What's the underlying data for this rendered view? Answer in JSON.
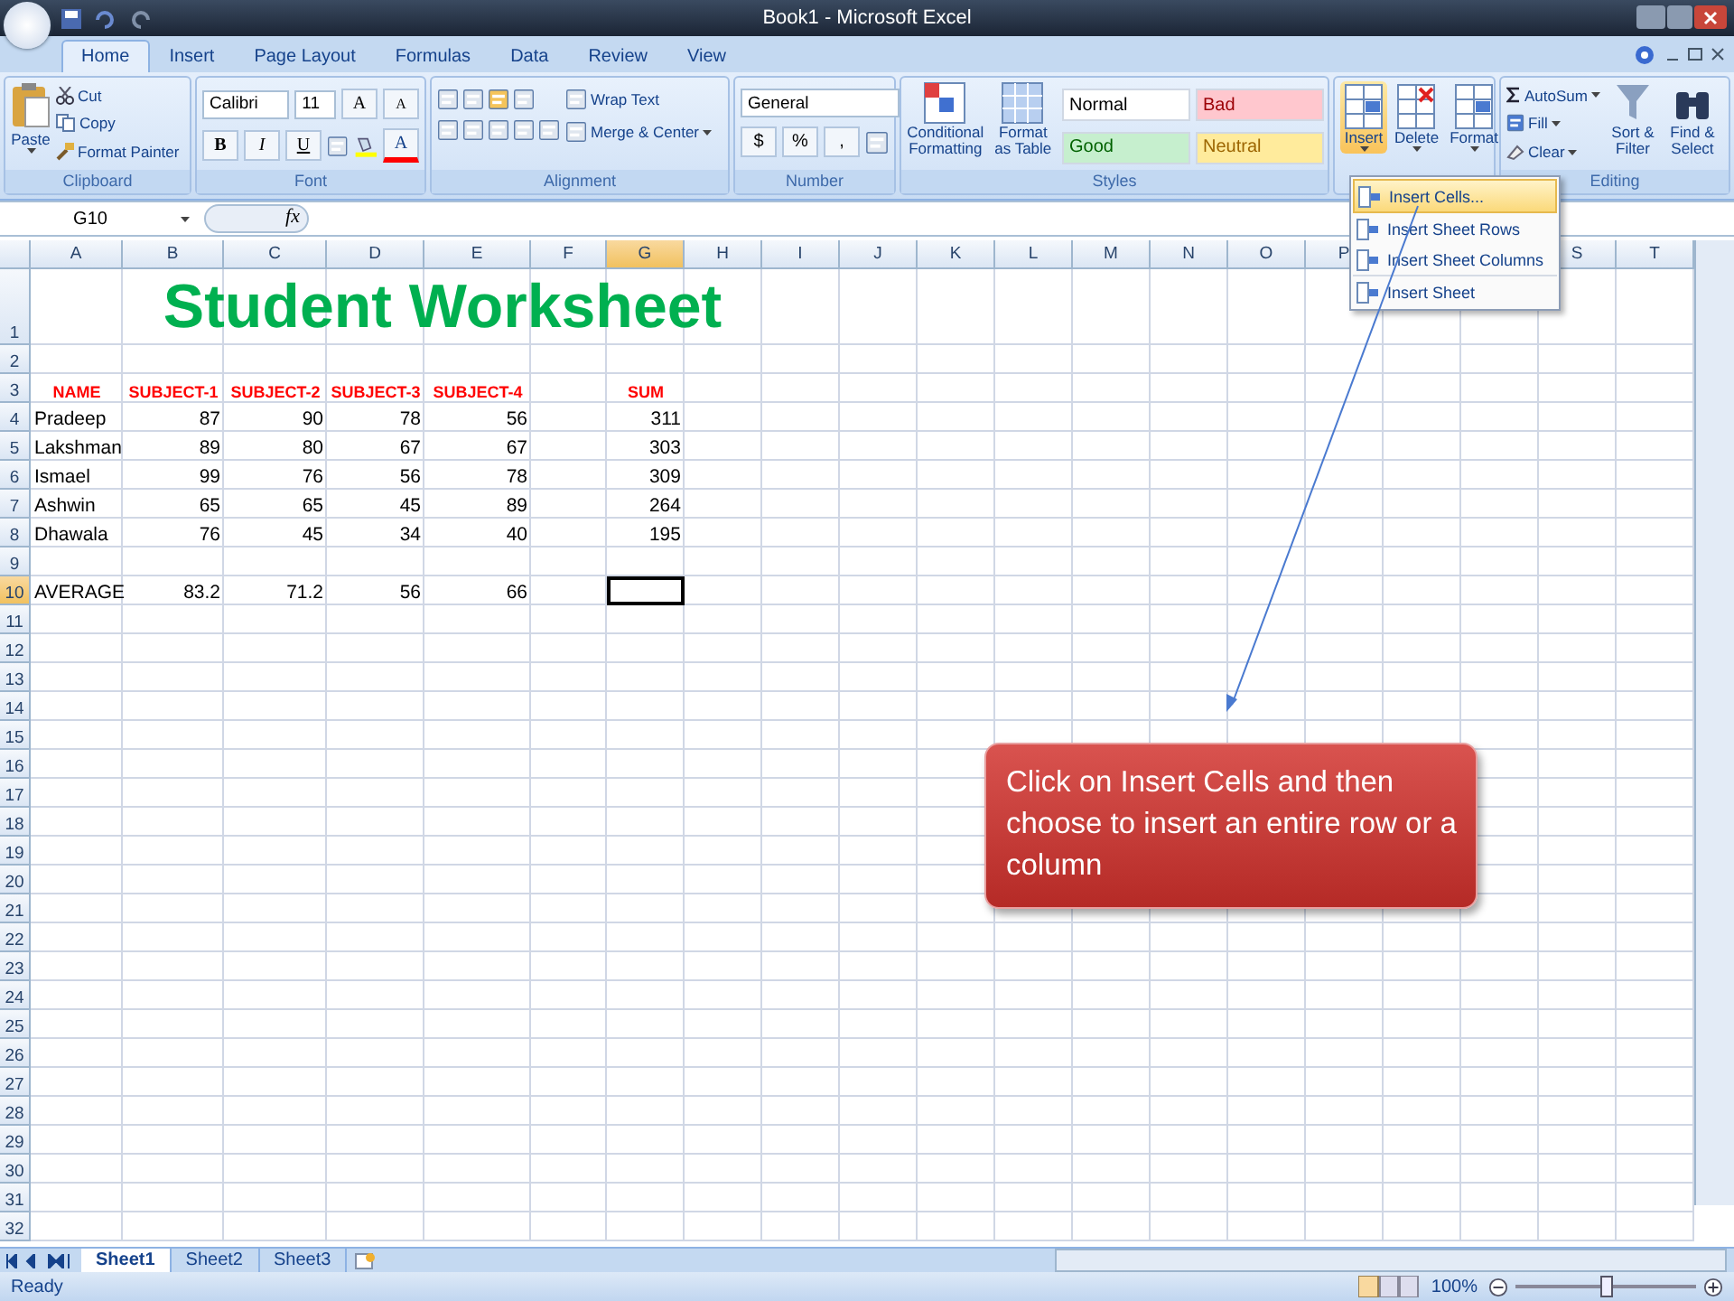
{
  "window": {
    "title": "Book1 - Microsoft Excel"
  },
  "ribbon_tabs": [
    {
      "label": "Home",
      "selected": true
    },
    {
      "label": "Insert",
      "selected": false
    },
    {
      "label": "Page Layout",
      "selected": false
    },
    {
      "label": "Formulas",
      "selected": false
    },
    {
      "label": "Data",
      "selected": false
    },
    {
      "label": "Review",
      "selected": false
    },
    {
      "label": "View",
      "selected": false
    }
  ],
  "clipboard": {
    "label": "Clipboard",
    "paste": "Paste",
    "cut": "Cut",
    "copy": "Copy",
    "format_painter": "Format Painter"
  },
  "font": {
    "label": "Font",
    "font_name": "Calibri",
    "font_size": "11",
    "grow": "A",
    "shrink": "A",
    "bold": "B",
    "italic": "I",
    "underline": "U",
    "font_color": "A"
  },
  "alignment": {
    "label": "Alignment",
    "wrap_text": "Wrap Text",
    "merge": "Merge & Center"
  },
  "number": {
    "label": "Number",
    "format": "General",
    "currency": "$",
    "percent": "%",
    "comma": ","
  },
  "styles": {
    "label": "Styles",
    "conditional": "Conditional Formatting",
    "format_table": "Format as Table",
    "cell_styles": [
      {
        "label": "Normal",
        "color": "#ffffff"
      },
      {
        "label": "Bad",
        "color": "#ffc7ce"
      },
      {
        "label": "Good",
        "color": "#c6efce"
      },
      {
        "label": "Neutral",
        "color": "#ffeb9c"
      }
    ]
  },
  "cells": {
    "buttons": [
      {
        "label": "Insert",
        "pressed": true
      },
      {
        "label": "Delete",
        "pressed": false
      },
      {
        "label": "Format",
        "pressed": false
      }
    ]
  },
  "editing": {
    "label": "Editing",
    "autosum": "AutoSum",
    "fill": "Fill",
    "clear": "Clear",
    "sort": "Sort & Filter",
    "find": "Find & Select"
  },
  "formula_bar": {
    "name_box": "G10",
    "fx": "fx"
  },
  "insert_menu": [
    {
      "label": "Insert Cells...",
      "selected": true
    },
    {
      "label": "Insert Sheet Rows",
      "selected": false
    },
    {
      "label": "Insert Sheet Columns",
      "selected": false
    },
    {
      "label": "Insert Sheet",
      "selected": false
    }
  ],
  "sheet": {
    "columns": [
      {
        "label": "A",
        "selected": false
      },
      {
        "label": "B",
        "selected": false
      },
      {
        "label": "C",
        "selected": false
      },
      {
        "label": "D",
        "selected": false
      },
      {
        "label": "E",
        "selected": false
      },
      {
        "label": "F",
        "selected": false
      },
      {
        "label": "G",
        "selected": true
      },
      {
        "label": "H",
        "selected": false
      },
      {
        "label": "I",
        "selected": false
      },
      {
        "label": "J",
        "selected": false
      },
      {
        "label": "K",
        "selected": false
      },
      {
        "label": "L",
        "selected": false
      },
      {
        "label": "M",
        "selected": false
      },
      {
        "label": "N",
        "selected": false
      },
      {
        "label": "O",
        "selected": false
      },
      {
        "label": "P",
        "selected": false
      },
      {
        "label": "S",
        "selected": false
      },
      {
        "label": "T",
        "selected": false
      }
    ],
    "rows": [
      {
        "number": "1",
        "selected": false,
        "kind": "title",
        "title": "Student Worksheet"
      },
      {
        "number": "2",
        "selected": false,
        "kind": "data"
      },
      {
        "number": "3",
        "selected": false,
        "kind": "heading",
        "cells": {
          "A": "NAME",
          "B": "SUBJECT-1",
          "C": "SUBJECT-2",
          "D": "SUBJECT-3",
          "E": "SUBJECT-4",
          "G": "SUM"
        }
      },
      {
        "number": "4",
        "selected": false,
        "kind": "data",
        "cells": {
          "A": "Pradeep",
          "B": "87",
          "C": "90",
          "D": "78",
          "E": "56",
          "G": "311"
        }
      },
      {
        "number": "5",
        "selected": false,
        "kind": "data",
        "cells": {
          "A": "Lakshman",
          "B": "89",
          "C": "80",
          "D": "67",
          "E": "67",
          "G": "303"
        }
      },
      {
        "number": "6",
        "selected": false,
        "kind": "data",
        "cells": {
          "A": "Ismael",
          "B": "99",
          "C": "76",
          "D": "56",
          "E": "78",
          "G": "309"
        }
      },
      {
        "number": "7",
        "selected": false,
        "kind": "data",
        "cells": {
          "A": "Ashwin",
          "B": "65",
          "C": "65",
          "D": "45",
          "E": "89",
          "G": "264"
        }
      },
      {
        "number": "8",
        "selected": false,
        "kind": "data",
        "cells": {
          "A": "Dhawala",
          "B": "76",
          "C": "45",
          "D": "34",
          "E": "40",
          "G": "195"
        }
      },
      {
        "number": "9",
        "selected": false,
        "kind": "data"
      },
      {
        "number": "10",
        "selected": true,
        "kind": "data",
        "cells": {
          "A": "AVERAGE",
          "B": "83.2",
          "C": "71.2",
          "D": "56",
          "E": "66"
        }
      },
      {
        "number": "11",
        "selected": false,
        "kind": "data"
      },
      {
        "number": "12",
        "selected": false,
        "kind": "data"
      },
      {
        "number": "13",
        "selected": false,
        "kind": "data"
      },
      {
        "number": "14",
        "selected": false,
        "kind": "data"
      },
      {
        "number": "15",
        "selected": false,
        "kind": "data"
      },
      {
        "number": "16",
        "selected": false,
        "kind": "data"
      },
      {
        "number": "17",
        "selected": false,
        "kind": "data"
      },
      {
        "number": "18",
        "selected": false,
        "kind": "data"
      },
      {
        "number": "19",
        "selected": false,
        "kind": "data"
      },
      {
        "number": "20",
        "selected": false,
        "kind": "data"
      },
      {
        "number": "21",
        "selected": false,
        "kind": "data"
      },
      {
        "number": "22",
        "selected": false,
        "kind": "data"
      },
      {
        "number": "23",
        "selected": false,
        "kind": "data"
      },
      {
        "number": "24",
        "selected": false,
        "kind": "data"
      },
      {
        "number": "25",
        "selected": false,
        "kind": "data"
      },
      {
        "number": "26",
        "selected": false,
        "kind": "data"
      },
      {
        "number": "27",
        "selected": false,
        "kind": "data"
      },
      {
        "number": "28",
        "selected": false,
        "kind": "data"
      },
      {
        "number": "29",
        "selected": false,
        "kind": "data"
      },
      {
        "number": "30",
        "selected": false,
        "kind": "data"
      },
      {
        "number": "31",
        "selected": false,
        "kind": "data"
      },
      {
        "number": "32",
        "selected": false,
        "kind": "data"
      }
    ]
  },
  "sheet_tabs": [
    {
      "label": "Sheet1",
      "selected": true
    },
    {
      "label": "Sheet2",
      "selected": false
    },
    {
      "label": "Sheet3",
      "selected": false
    }
  ],
  "callout": {
    "text": "Click on Insert Cells and then choose to insert an entire row or a column"
  },
  "status_bar": {
    "status": "Ready",
    "zoom": "100%",
    "zoom_slider": {
      "level": 0.5
    }
  }
}
